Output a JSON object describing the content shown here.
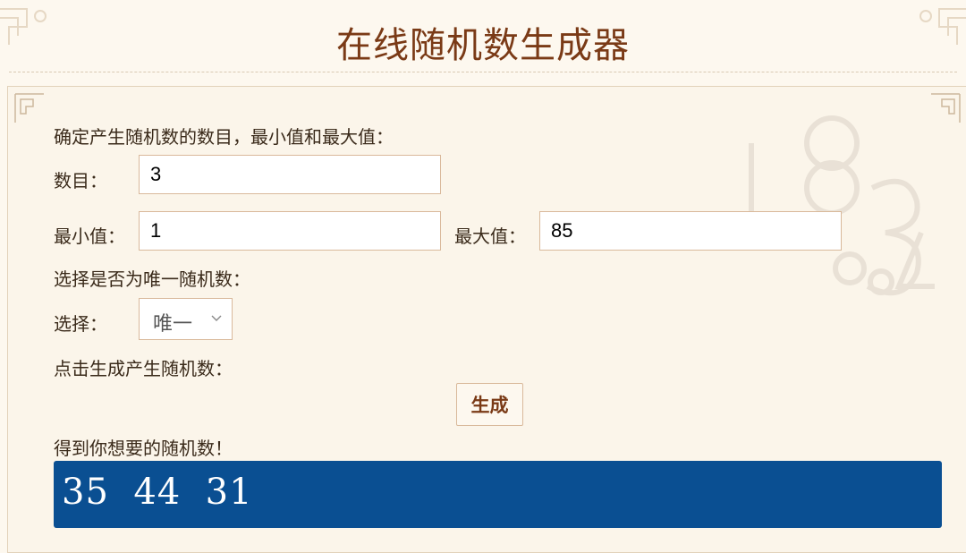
{
  "page": {
    "title": "在线随机数生成器"
  },
  "form": {
    "intro_label": "确定产生随机数的数目，最小值和最大值：",
    "count_label": "数目：",
    "count_value": "3",
    "min_label": "最小值：",
    "min_value": "1",
    "max_label": "最大值：",
    "max_value": "85",
    "unique_prompt": "选择是否为唯一随机数：",
    "select_label": "选择：",
    "select_value": "唯一",
    "generate_prompt": "点击生成产生随机数：",
    "generate_button": "生成",
    "result_label": "得到你想要的随机数！"
  },
  "result": {
    "numbers": "35  44  31"
  },
  "icons": [
    "corner-ornament-icon",
    "chevron-down-icon",
    "number-background-decoration"
  ],
  "colors": {
    "background": "#fdf8ef",
    "title": "#7a3a16",
    "field_border": "#d9b99b",
    "result_bg": "#0a4f92",
    "result_text": "#ffffff"
  }
}
